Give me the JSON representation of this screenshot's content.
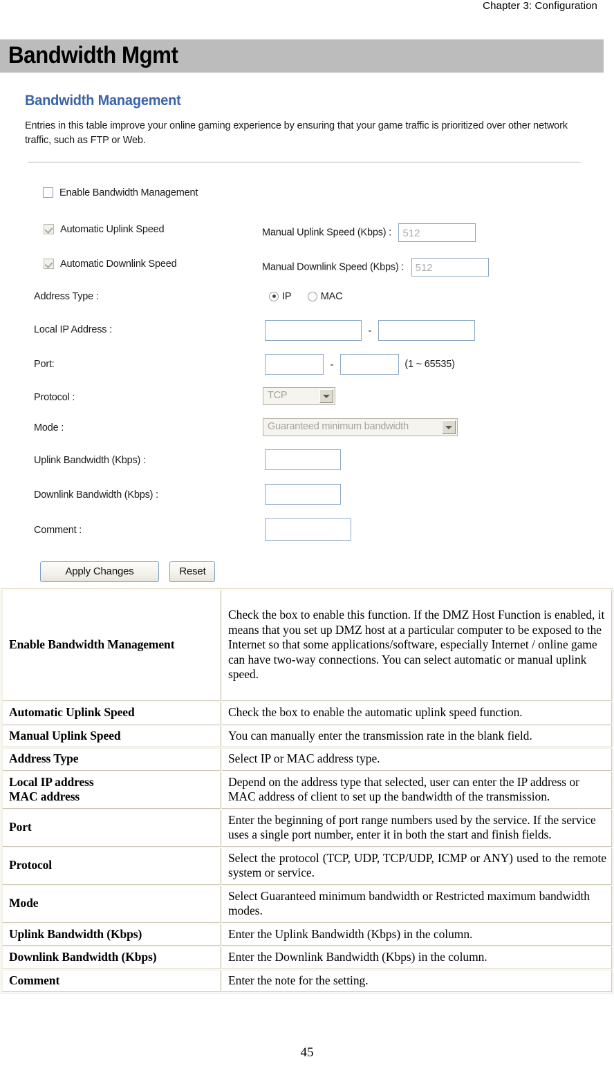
{
  "header": {
    "chapter": "Chapter 3: Configuration"
  },
  "title_band": {
    "title": "Bandwidth Mgmt"
  },
  "panel": {
    "heading": "Bandwidth Management",
    "description": "Entries in this table improve your online gaming experience by ensuring that your game traffic is prioritized over other network traffic, such as FTP or Web.",
    "enable_checkbox": {
      "label": "Enable Bandwidth Management",
      "checked": false
    },
    "auto_uplink": {
      "label": "Automatic Uplink Speed",
      "checked": true
    },
    "auto_downlink": {
      "label": "Automatic Downlink Speed",
      "checked": true
    },
    "manual_uplink": {
      "label": "Manual Uplink Speed (Kbps) :",
      "value": "512"
    },
    "manual_downlink": {
      "label": "Manual Downlink Speed (Kbps) :",
      "value": "512"
    },
    "address_type": {
      "label": "Address Type :",
      "option_ip": "IP",
      "option_mac": "MAC",
      "selected": "IP"
    },
    "local_ip": {
      "label": "Local IP Address :",
      "start": "",
      "end": "",
      "separator": "-"
    },
    "port": {
      "label": "Port:",
      "start": "",
      "end": "",
      "separator": "-",
      "hint": "(1 ~ 65535)"
    },
    "protocol": {
      "label": "Protocol :",
      "value": "TCP"
    },
    "mode": {
      "label": "Mode :",
      "value": "Guaranteed minimum bandwidth"
    },
    "uplink_bandwidth": {
      "label": "Uplink Bandwidth (Kbps) :",
      "value": ""
    },
    "downlink_bandwidth": {
      "label": "Downlink Bandwidth (Kbps) :",
      "value": ""
    },
    "comment": {
      "label": "Comment :",
      "value": ""
    },
    "buttons": {
      "apply": "Apply Changes",
      "reset": "Reset"
    }
  },
  "description_table": {
    "rows": [
      {
        "term": "Enable Bandwidth Management",
        "definition": "Check the box to enable this function. If the DMZ Host Function is enabled, it means that you set up DMZ host at a particular computer to be exposed to the Internet so that some applications/software, especially Internet / online game can have two-way connections. You can select automatic or manual uplink speed."
      },
      {
        "term": "Automatic Uplink Speed",
        "definition": "Check the box to enable the automatic uplink speed function."
      },
      {
        "term": "Manual Uplink Speed",
        "definition": "You can manually enter the transmission rate in the blank field."
      },
      {
        "term": "Address Type",
        "definition": "Select IP or MAC address type."
      },
      {
        "term": "Local IP address\nMAC address",
        "definition": "Depend on the address type that selected, user can enter the IP address or MAC address of client to set up the bandwidth of the transmission."
      },
      {
        "term": "Port",
        "definition": "Enter the beginning of port range numbers used by the service. If the service uses a single port number, enter it in both the start and finish fields."
      },
      {
        "term": "Protocol",
        "definition": "Select the protocol (TCP, UDP, TCP/UDP, ICMP or ANY) used to the remote system or service."
      },
      {
        "term": "Mode",
        "definition": "Select Guaranteed minimum bandwidth or Restricted maximum bandwidth modes."
      },
      {
        "term": "Uplink Bandwidth (Kbps)",
        "definition": "Enter the Uplink Bandwidth (Kbps) in the column."
      },
      {
        "term": "Downlink Bandwidth (Kbps)",
        "definition": "Enter the Downlink Bandwidth (Kbps) in the column."
      },
      {
        "term": "Comment",
        "definition": "Enter the note for the setting."
      }
    ]
  },
  "footer": {
    "page_number": "45"
  }
}
